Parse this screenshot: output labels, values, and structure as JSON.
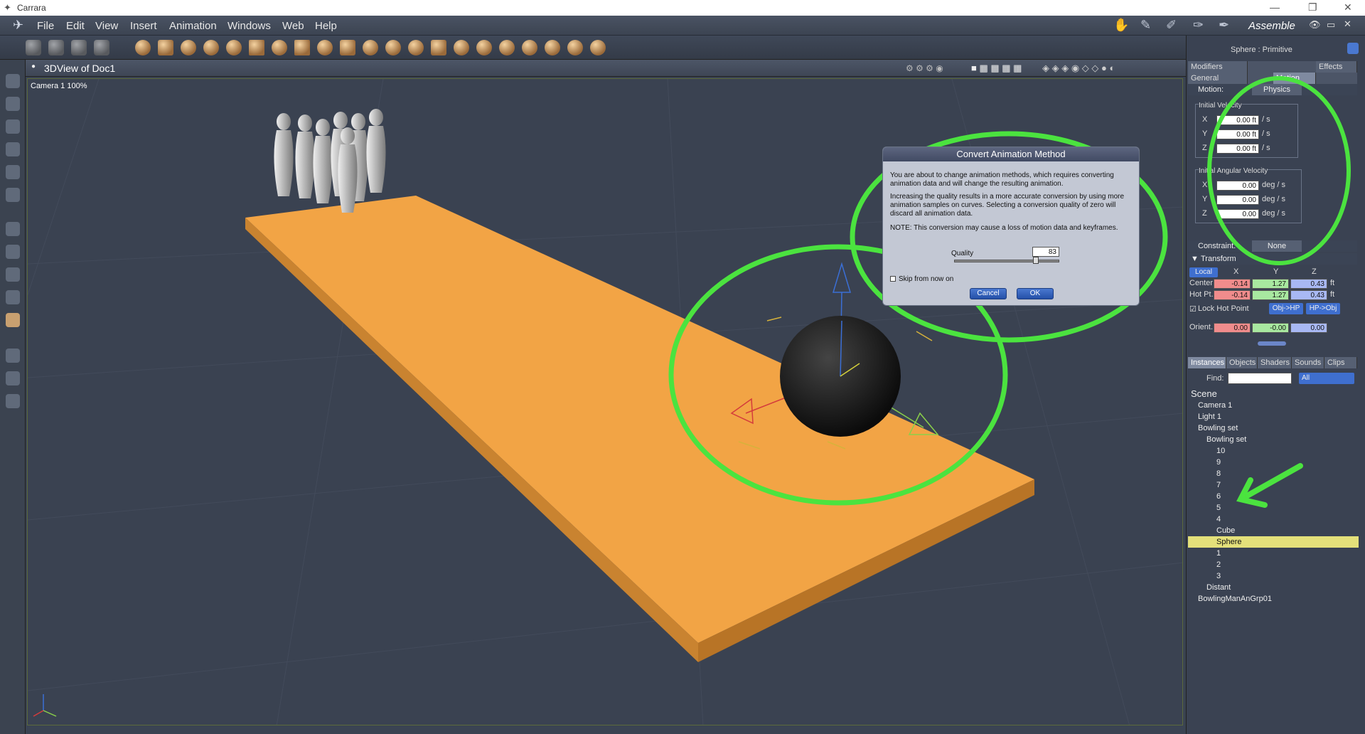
{
  "app": {
    "title": "Carrara",
    "mode_label": "Assemble"
  },
  "menu": [
    "File",
    "Edit",
    "View",
    "Insert",
    "Animation",
    "Windows",
    "Web",
    "Help"
  ],
  "view": {
    "title": "3DView of Doc1",
    "camera_label": "Camera 1 100%"
  },
  "dialog": {
    "title": "Convert Animation Method",
    "para1": "You are about to change animation methods, which requires converting animation data and will change the resulting animation.",
    "para2": "Increasing the quality results in a more accurate conversion by using more animation samples on curves.  Selecting a conversion quality of zero will discard all animation data.",
    "para3": "NOTE: This conversion may cause a loss of motion data and keyframes.",
    "quality_label": "Quality",
    "quality_value": "83",
    "skip_label": "Skip from now on",
    "cancel": "Cancel",
    "ok": "OK"
  },
  "panel": {
    "object_title": "Sphere : Primitive",
    "tabs_top": [
      "Modifiers",
      "Effects"
    ],
    "tabs_sub": [
      "General",
      "Motion"
    ],
    "motion_label": "Motion:",
    "motion_value": "Physics",
    "initial_velocity": {
      "title": "Initial Velocity",
      "unit": "/ s",
      "x": "0.00 ft",
      "y": "0.00 ft",
      "z": "0.00 ft"
    },
    "initial_angular_velocity": {
      "title": "Initial Angular Velocity",
      "unit": "deg / s",
      "x": "0.00",
      "y": "0.00",
      "z": "0.00"
    },
    "axis_x": "X",
    "axis_y": "Y",
    "axis_z": "Z",
    "constraint_label": "Constraint:",
    "constraint_value": "None",
    "transform_label": "Transform",
    "local_label": "Local",
    "center_label": "Center",
    "hotpt_label": "Hot Pt.",
    "center": {
      "x": "-0.14",
      "y": "1.27",
      "z": "0.43"
    },
    "hotpt": {
      "x": "-0.14",
      "y": "1.27",
      "z": "0.43"
    },
    "unit_ft": "ft",
    "lock_hot_point": "Lock Hot Point",
    "obj_hp": "Obj->HP",
    "hp_obj": "HP->Obj",
    "orient_label": "Orient.",
    "orient": {
      "x": "0.00",
      "y": "-0.00",
      "z": "0.00"
    }
  },
  "browser": {
    "tabs": [
      "Instances",
      "Objects",
      "Shaders",
      "Sounds",
      "Clips"
    ],
    "find_label": "Find:",
    "find_value": "",
    "filter": "All",
    "tree": [
      "Scene",
      "Camera 1",
      "Light 1",
      "Bowling set",
      "Bowling set",
      "10",
      "9",
      "8",
      "7",
      "6",
      "5",
      "4",
      "Cube",
      "Sphere",
      "1",
      "2",
      "3",
      "Distant",
      "BowlingManAnGrp01"
    ],
    "selected": "Sphere"
  },
  "colors": {
    "accent_green": "#4be33f",
    "lane": "#f0a040",
    "selection": "#e4e07a"
  }
}
